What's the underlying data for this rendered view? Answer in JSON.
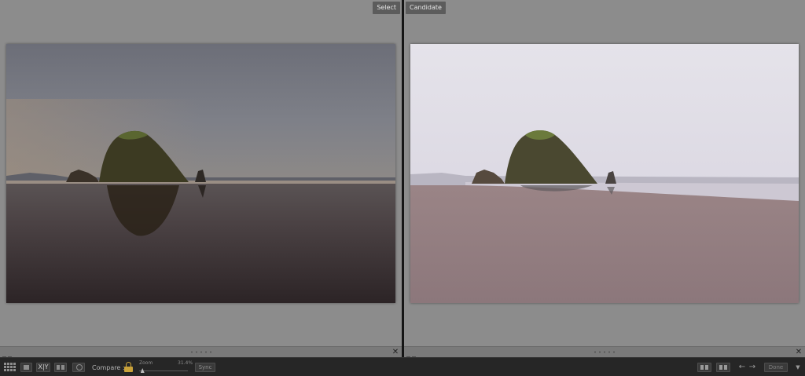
{
  "left_panel": {
    "label": "Select"
  },
  "right_panel": {
    "label": "Candidate"
  },
  "film_strip": {
    "close_glyph": "✕"
  },
  "toolbar": {
    "view_icons": [
      "grid-view-icon",
      "loupe-view-icon",
      "compare-view-icon",
      "survey-view-icon",
      "people-view-icon"
    ],
    "compare_view_text": "X|Y",
    "compare_label": "Compare :",
    "zoom_label": "Zoom",
    "zoom_value": "31.4%",
    "zoom_level": 0.06,
    "sync_label": "Sync",
    "done_label": "Done",
    "prev_glyph": "←",
    "next_glyph": "→",
    "menu_glyph": "▼"
  },
  "colors": {
    "panel_background": "#8c8c8c",
    "toolbar_background": "#262626",
    "lock_accent": "#c9a23a"
  }
}
